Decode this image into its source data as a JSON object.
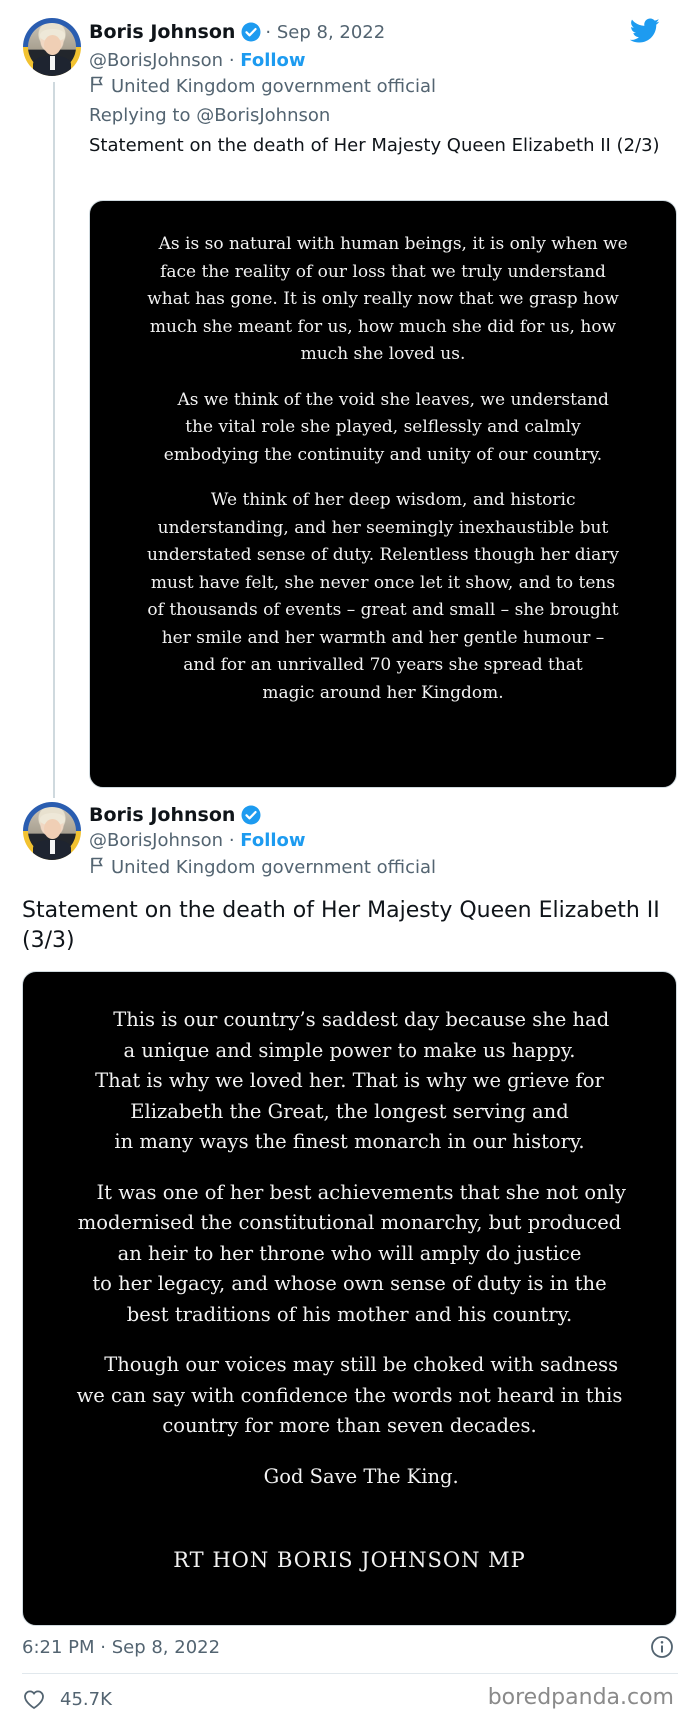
{
  "tweet1": {
    "name": "Boris Johnson",
    "date": "· Sep 8, 2022",
    "handle": "@BorisJohnson",
    "separator": "·",
    "follow": "Follow",
    "label": "United Kingdom government official",
    "replying": "Replying to @BorisJohnson",
    "text": "Statement on the death of Her Majesty Queen Elizabeth II (2/3)",
    "statement": [
      [
        "As is so natural with human beings, it is only when we",
        "face the reality of our loss that we truly understand",
        "what has gone. It is only really now that we grasp how",
        "much she meant for us, how much she did for us, how",
        "much she loved us."
      ],
      [
        "As we think of the void she leaves, we understand",
        "the vital role she played, selflessly and calmly",
        "embodying the continuity and unity of our country."
      ],
      [
        "We think of her deep wisdom, and historic",
        "understanding, and her seemingly inexhaustible but",
        "understated sense of duty. Relentless though her diary",
        "must have felt, she never once let it show, and to tens",
        "of thousands of events – great and small – she brought",
        "her smile and her warmth and her gentle humour –",
        "and for an unrivalled 70 years she spread that",
        "magic around her Kingdom."
      ]
    ]
  },
  "tweet2": {
    "name": "Boris Johnson",
    "handle": "@BorisJohnson",
    "separator": "·",
    "follow": "Follow",
    "label": "United Kingdom government official",
    "text": "Statement on the death of Her Majesty Queen Elizabeth II (3/3)",
    "statement": [
      [
        "This is our country’s saddest day because she had",
        "a unique and simple power to make us happy.",
        "That is why we loved her. That is why we grieve for",
        "Elizabeth the Great, the longest serving and",
        "in many ways the finest monarch in our history."
      ],
      [
        "It was one of her best achievements that she not only",
        "modernised the constitutional monarchy, but produced",
        "an heir to her throne who will amply do justice",
        "to her legacy, and whose own sense of duty is in the",
        "best traditions of his mother and his country."
      ],
      [
        "Though our voices may still be choked with sadness",
        "we can say with confidence the words not heard in this",
        "country for more than seven decades."
      ],
      [
        "God Save The King."
      ]
    ],
    "signature": "RT HON BORIS JOHNSON MP",
    "timestamp": "6:21 PM · Sep 8, 2022",
    "likes": "45.7K"
  },
  "watermark": "boredpanda.com",
  "colors": {
    "accent": "#1d9bf0",
    "muted": "#536471",
    "verified": "#1d9bf0"
  },
  "icons": [
    "twitter-bird-icon",
    "verified-badge-icon",
    "flag-icon",
    "info-icon",
    "heart-icon"
  ]
}
